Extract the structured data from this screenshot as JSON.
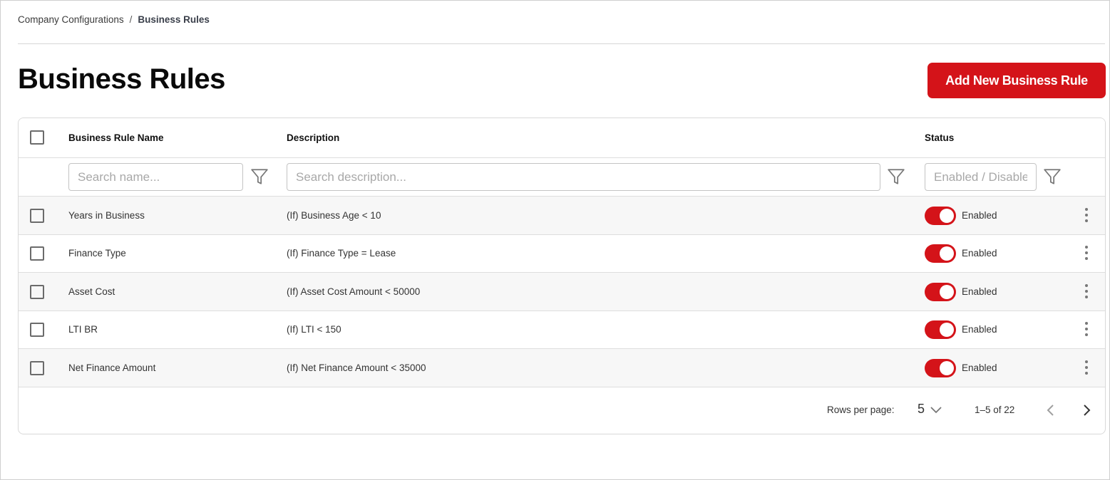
{
  "breadcrumb": {
    "parent": "Company Configurations",
    "separator": "/",
    "current": "Business Rules"
  },
  "page": {
    "title": "Business Rules",
    "add_button_label": "Add New Business Rule"
  },
  "table": {
    "columns": {
      "name": "Business Rule Name",
      "description": "Description",
      "status": "Status"
    },
    "filters": {
      "name_placeholder": "Search name...",
      "description_placeholder": "Search description...",
      "status_placeholder": "Enabled / Disabled"
    },
    "rows": [
      {
        "name": "Years in Business",
        "description": "(If) Business Age < 10",
        "status": "Enabled",
        "enabled": true
      },
      {
        "name": "Finance Type",
        "description": "(If) Finance Type = Lease",
        "status": "Enabled",
        "enabled": true
      },
      {
        "name": "Asset Cost",
        "description": "(If) Asset Cost Amount < 50000",
        "status": "Enabled",
        "enabled": true
      },
      {
        "name": "LTI BR",
        "description": "(If) LTI < 150",
        "status": "Enabled",
        "enabled": true
      },
      {
        "name": "Net Finance Amount",
        "description": "(If) Net Finance Amount < 35000",
        "status": "Enabled",
        "enabled": true
      }
    ]
  },
  "pagination": {
    "rows_per_page_label": "Rows per page:",
    "rows_per_page": "5",
    "range": "1–5 of 22"
  },
  "colors": {
    "accent": "#d41319",
    "row_shade": "#f7f7f7",
    "border": "#d9d9d9"
  },
  "icons": {
    "filter": "filter-icon",
    "kebab": "more-vertical-icon",
    "prev": "chevron-left-icon",
    "next": "chevron-right-icon",
    "dropdown": "chevron-down-icon"
  }
}
